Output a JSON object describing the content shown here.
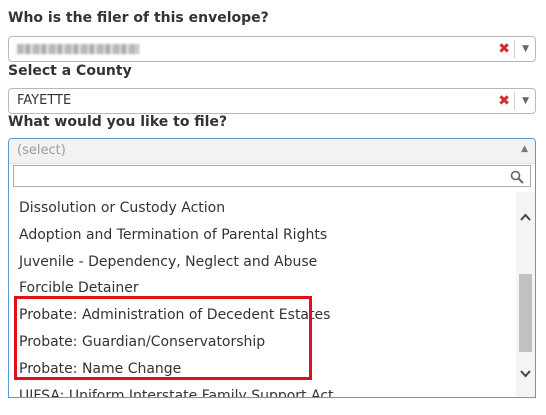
{
  "filer": {
    "label": "Who is the filer of this envelope?",
    "value_obscured": true,
    "clear_glyph": "✖",
    "arrow_glyph": "▼"
  },
  "county": {
    "label": "Select a County",
    "value": "FAYETTE",
    "clear_glyph": "✖",
    "arrow_glyph": "▼"
  },
  "file_type": {
    "label": "What would you like to file?",
    "placeholder": "(select)",
    "arrow_glyph": "▲",
    "search_value": "",
    "options": [
      "Dissolution or Custody Action",
      "Adoption and Termination of Parental Rights",
      "Juvenile - Dependency, Neglect and Abuse",
      "Forcible Detainer",
      "Probate: Administration of Decedent Estates",
      "Probate: Guardian/Conservatorship",
      "Probate: Name Change",
      "UIFSA: Uniform Interstate Family Support Act"
    ],
    "highlighted_options": [
      "Probate: Administration of Decedent Estates",
      "Probate: Guardian/Conservatorship",
      "Probate: Name Change"
    ]
  },
  "colors": {
    "highlight_border": "#e0101b",
    "clear_icon": "#d62b2b",
    "focus_border": "#5b9bd5"
  },
  "icons": {
    "search": "magnifier-icon",
    "scroll_up": "chevron-up-icon",
    "scroll_down": "chevron-down-icon"
  }
}
